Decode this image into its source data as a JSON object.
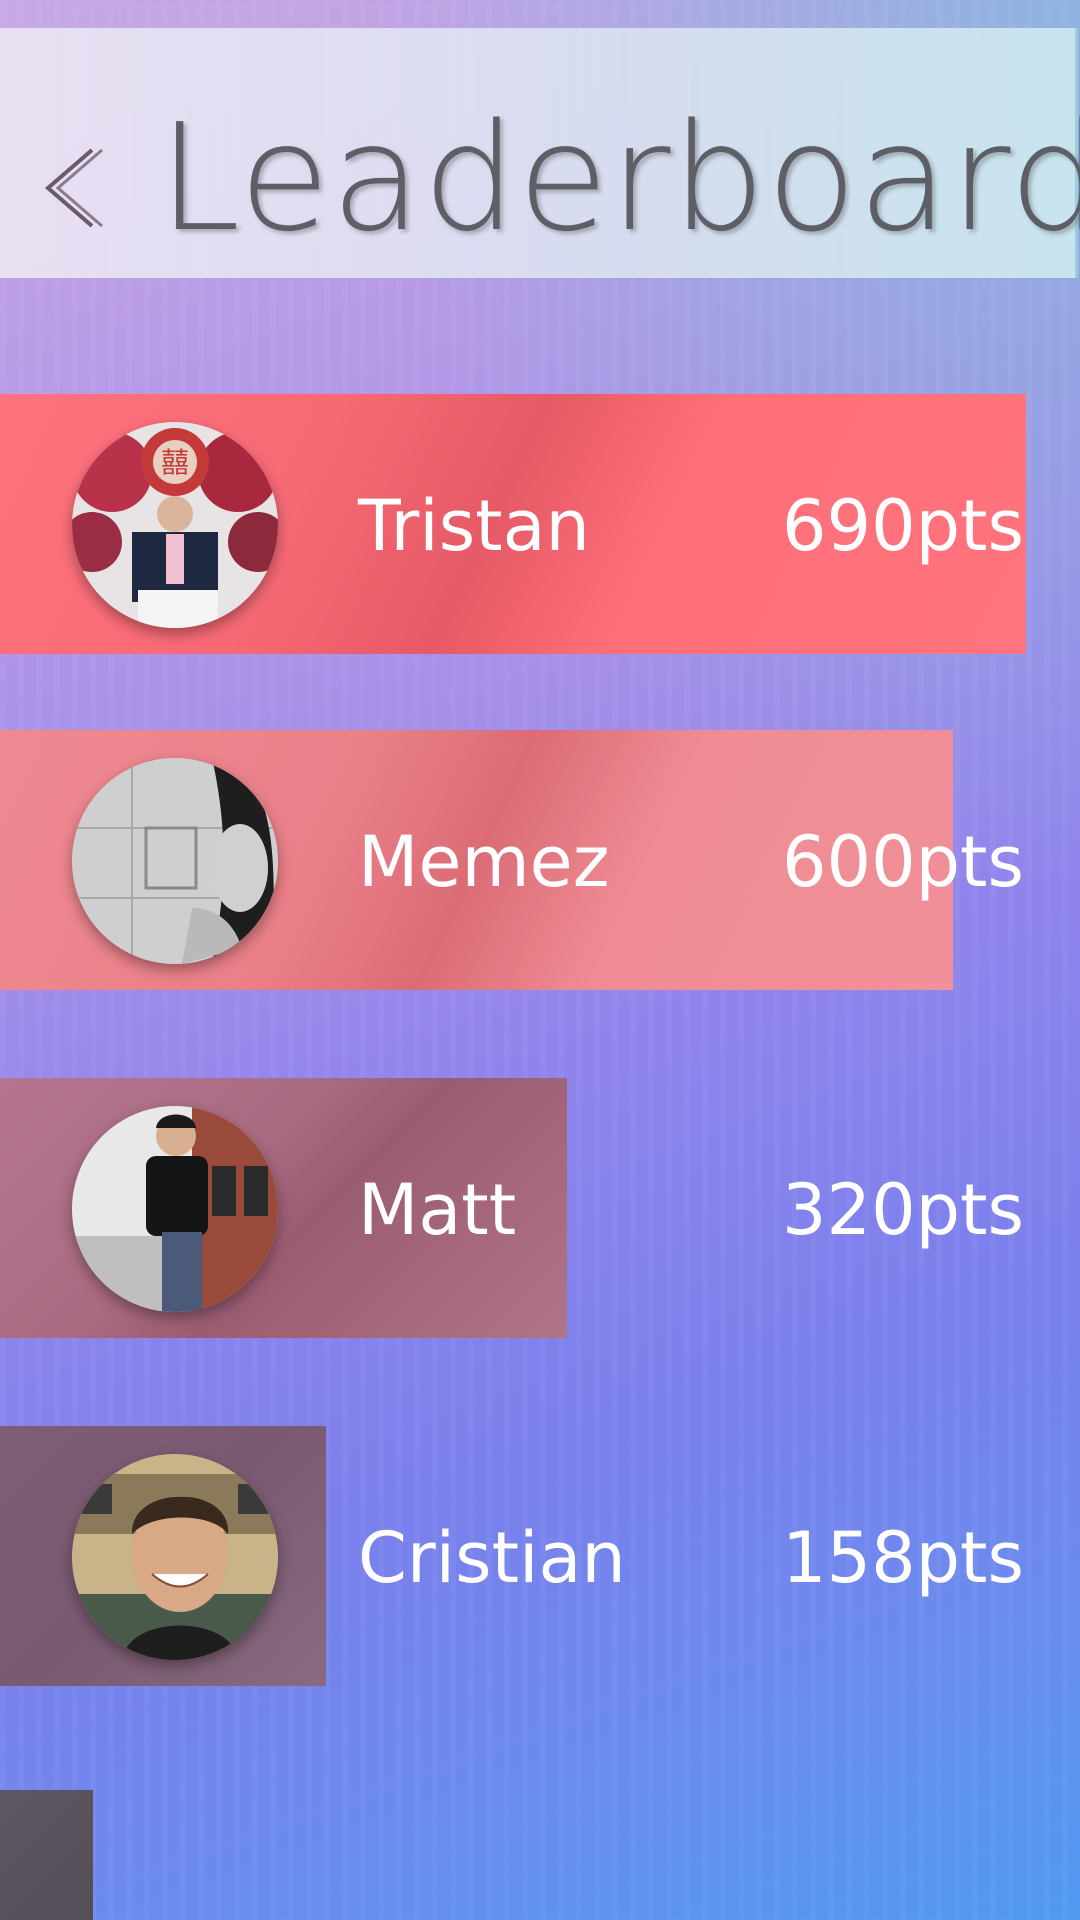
{
  "header": {
    "title": "Leaderboard",
    "back_icon": "chevron-left-icon"
  },
  "colors": {
    "rank1_bar": "#ff6f7a",
    "rank2_bar": "#ee8c92",
    "rank3_bar": "#a96b82",
    "rank4_bar": "#7a5a72",
    "rank5_bar": "#5c5560"
  },
  "leaderboard": [
    {
      "name": "Tristan",
      "points": "690pts",
      "score": 690
    },
    {
      "name": "Memez",
      "points": "600pts",
      "score": 600
    },
    {
      "name": "Matt",
      "points": "320pts",
      "score": 320
    },
    {
      "name": "Cristian",
      "points": "158pts",
      "score": 158
    }
  ]
}
